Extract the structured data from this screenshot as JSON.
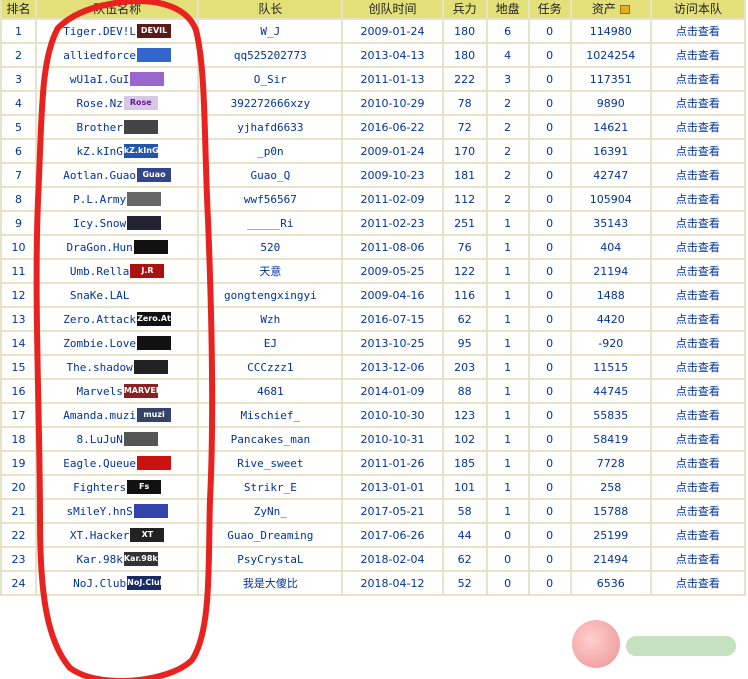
{
  "columns": {
    "rank": "排名",
    "team": "队伍名称",
    "captain": "队长",
    "created": "创队时间",
    "troops": "兵力",
    "territory": "地盘",
    "tasks": "任务",
    "assets": "资产",
    "visit": "访问本队"
  },
  "visit_label": "点击查看",
  "rows": [
    {
      "rank": "1",
      "name": "Tiger.DEV!L",
      "logo": "DEVIL",
      "captain": "W_J",
      "created": "2009-01-24",
      "troops": "180",
      "territory": "6",
      "tasks": "0",
      "assets": "114980"
    },
    {
      "rank": "2",
      "name": "alliedforce",
      "logo": "",
      "captain": "qq525202773",
      "created": "2013-04-13",
      "troops": "180",
      "territory": "4",
      "tasks": "0",
      "assets": "1024254"
    },
    {
      "rank": "3",
      "name": "wU1aI.GuI",
      "logo": "",
      "captain": "O_Sir",
      "created": "2011-01-13",
      "troops": "222",
      "territory": "3",
      "tasks": "0",
      "assets": "117351"
    },
    {
      "rank": "4",
      "name": "Rose.Nz",
      "logo": "Rose",
      "captain": "392272666xzy",
      "created": "2010-10-29",
      "troops": "78",
      "territory": "2",
      "tasks": "0",
      "assets": "9890"
    },
    {
      "rank": "5",
      "name": "Brother",
      "logo": "",
      "captain": "yjhafd6633",
      "created": "2016-06-22",
      "troops": "72",
      "territory": "2",
      "tasks": "0",
      "assets": "14621"
    },
    {
      "rank": "6",
      "name": "kZ.kInG",
      "logo": "kZ.kInG",
      "captain": "_p0n",
      "created": "2009-01-24",
      "troops": "170",
      "territory": "2",
      "tasks": "0",
      "assets": "16391"
    },
    {
      "rank": "7",
      "name": "Aotlan.Guao",
      "logo": "Guao",
      "captain": "Guao_Q",
      "created": "2009-10-23",
      "troops": "181",
      "territory": "2",
      "tasks": "0",
      "assets": "42747"
    },
    {
      "rank": "8",
      "name": "P.L.Army",
      "logo": "",
      "captain": "wwf56567",
      "created": "2011-02-09",
      "troops": "112",
      "territory": "2",
      "tasks": "0",
      "assets": "105904"
    },
    {
      "rank": "9",
      "name": "Icy.Snow",
      "logo": "",
      "captain": "_____Ri",
      "created": "2011-02-23",
      "troops": "251",
      "territory": "1",
      "tasks": "0",
      "assets": "35143"
    },
    {
      "rank": "10",
      "name": "DraGon.Hun",
      "logo": "",
      "captain": "520",
      "created": "2011-08-06",
      "troops": "76",
      "territory": "1",
      "tasks": "0",
      "assets": "404"
    },
    {
      "rank": "11",
      "name": "Umb.Rella",
      "logo": "J.R",
      "captain": "天意",
      "created": "2009-05-25",
      "troops": "122",
      "territory": "1",
      "tasks": "0",
      "assets": "21194"
    },
    {
      "rank": "12",
      "name": "SnaKe.LAL",
      "logo": "",
      "captain": "gongtengxingyi",
      "created": "2009-04-16",
      "troops": "116",
      "territory": "1",
      "tasks": "0",
      "assets": "1488"
    },
    {
      "rank": "13",
      "name": "Zero.Attack",
      "logo": "Zero.Attack",
      "captain": "Wzh",
      "created": "2016-07-15",
      "troops": "62",
      "territory": "1",
      "tasks": "0",
      "assets": "4420"
    },
    {
      "rank": "14",
      "name": "Zombie.Love",
      "logo": "",
      "captain": "EJ",
      "created": "2013-10-25",
      "troops": "95",
      "territory": "1",
      "tasks": "0",
      "assets": "-920"
    },
    {
      "rank": "15",
      "name": "The.shadow",
      "logo": "",
      "captain": "CCCzzz1",
      "created": "2013-12-06",
      "troops": "203",
      "territory": "1",
      "tasks": "0",
      "assets": "11515"
    },
    {
      "rank": "16",
      "name": "Marvels",
      "logo": "MARVEL",
      "captain": "4681",
      "created": "2014-01-09",
      "troops": "88",
      "territory": "1",
      "tasks": "0",
      "assets": "44745"
    },
    {
      "rank": "17",
      "name": "Amanda.muzi",
      "logo": "muzi",
      "captain": "Mischief_",
      "created": "2010-10-30",
      "troops": "123",
      "territory": "1",
      "tasks": "0",
      "assets": "55835"
    },
    {
      "rank": "18",
      "name": "8.LuJuN",
      "logo": "",
      "captain": "Pancakes_man",
      "created": "2010-10-31",
      "troops": "102",
      "territory": "1",
      "tasks": "0",
      "assets": "58419"
    },
    {
      "rank": "19",
      "name": "Eagle.Queue",
      "logo": "",
      "captain": "Rive_sweet",
      "created": "2011-01-26",
      "troops": "185",
      "territory": "1",
      "tasks": "0",
      "assets": "7728"
    },
    {
      "rank": "20",
      "name": "Fighters",
      "logo": "Fs",
      "captain": "Strikr_E",
      "created": "2013-01-01",
      "troops": "101",
      "territory": "1",
      "tasks": "0",
      "assets": "258"
    },
    {
      "rank": "21",
      "name": "sMileY.hnS",
      "logo": "",
      "captain": "ZyNn_",
      "created": "2017-05-21",
      "troops": "58",
      "territory": "1",
      "tasks": "0",
      "assets": "15788"
    },
    {
      "rank": "22",
      "name": "XT.Hacker",
      "logo": "XT",
      "captain": "Guao_Dreaming",
      "created": "2017-06-26",
      "troops": "44",
      "territory": "0",
      "tasks": "0",
      "assets": "25199"
    },
    {
      "rank": "23",
      "name": "Kar.98k",
      "logo": "Kar.98k",
      "captain": "PsyCrystaL",
      "created": "2018-02-04",
      "troops": "62",
      "territory": "0",
      "tasks": "0",
      "assets": "21494"
    },
    {
      "rank": "24",
      "name": "NoJ.Club",
      "logo": "NoJ.Club",
      "captain": "我是大傻比",
      "created": "2018-04-12",
      "troops": "52",
      "territory": "0",
      "tasks": "0",
      "assets": "6536"
    }
  ],
  "colors": {
    "header_bg": "#e3e07a",
    "grid": "#e6e3c8",
    "link_text": "#003399",
    "annotation": "#e8231f"
  },
  "annotation": {
    "shape": "hand-drawn-ellipse",
    "target": "team-name-column"
  }
}
